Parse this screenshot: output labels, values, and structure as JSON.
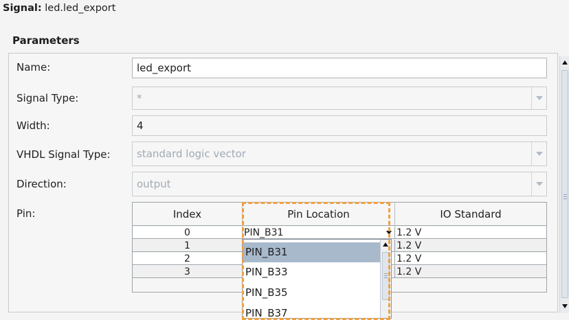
{
  "header": {
    "signal_label": "Signal:",
    "signal_value": "led.led_export"
  },
  "parameters": {
    "title": "Parameters",
    "name_label": "Name:",
    "name_value": "led_export",
    "signal_type_label": "Signal Type:",
    "signal_type_value": "*",
    "width_label": "Width:",
    "width_value": "4",
    "vhdl_label": "VHDL Signal Type:",
    "vhdl_value": "standard logic vector",
    "direction_label": "Direction:",
    "direction_value": "output",
    "pin_label": "Pin:"
  },
  "pin_table": {
    "columns": [
      "Index",
      "Pin Location",
      "IO Standard"
    ],
    "rows": [
      {
        "index": "0",
        "location": "PIN_B31",
        "io": "1.2 V"
      },
      {
        "index": "1",
        "location": "",
        "io": "1.2 V"
      },
      {
        "index": "2",
        "location": "",
        "io": "1.2 V"
      },
      {
        "index": "3",
        "location": "",
        "io": "1.2 V"
      }
    ]
  },
  "dropdown": {
    "options": [
      "PIN_B31",
      "PIN_B33",
      "PIN_B35",
      "PIN_B37"
    ],
    "selected": "PIN_B31"
  },
  "colors": {
    "highlight": "#f0a040",
    "selection": "#a8b9cc"
  }
}
